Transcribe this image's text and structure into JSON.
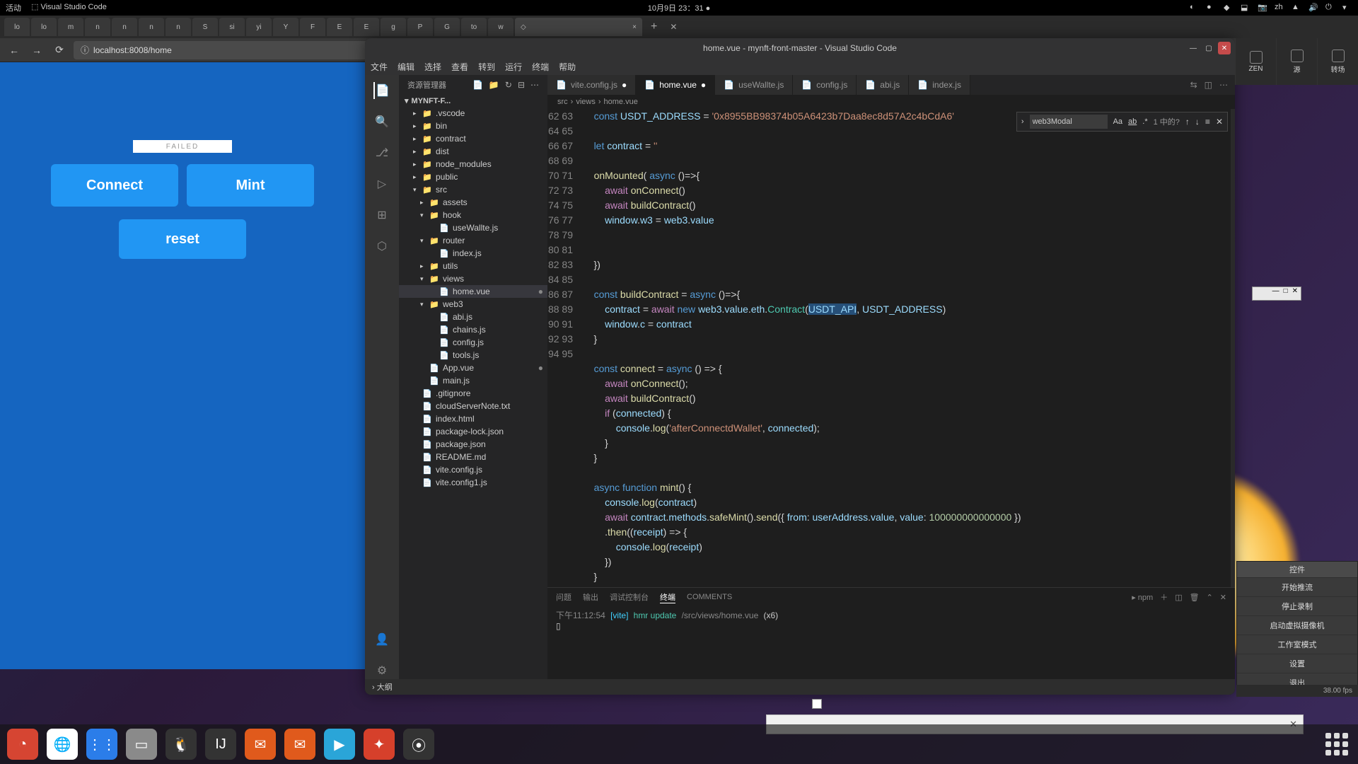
{
  "sys": {
    "activity": "活动",
    "app": "Visual Studio Code",
    "datetime": "10月9日 23：31"
  },
  "ff": {
    "tabs": [
      "lo",
      "lo",
      "m",
      "n",
      "n",
      "n",
      "n",
      "S",
      "si",
      "yi",
      "Y",
      "F",
      "E",
      "E",
      "g",
      "P",
      "G",
      "to",
      "w"
    ],
    "close": "×",
    "plus": "+",
    "url": "localhost:8008/home"
  },
  "page": {
    "failed": "FAILED",
    "connect": "Connect",
    "mint": "Mint",
    "reset": "reset"
  },
  "vsc": {
    "title": "home.vue - mynft-front-master - Visual Studio Code",
    "menu": [
      "文件",
      "编辑",
      "选择",
      "查看",
      "转到",
      "运行",
      "终端",
      "帮助"
    ],
    "side_hdr": "资源管理器",
    "root": "MYNFT-F...",
    "tree": [
      {
        "n": ".vscode",
        "d": 0,
        "f": true
      },
      {
        "n": "bin",
        "d": 0,
        "f": true
      },
      {
        "n": "contract",
        "d": 0,
        "f": true
      },
      {
        "n": "dist",
        "d": 0,
        "f": true
      },
      {
        "n": "node_modules",
        "d": 0,
        "f": true
      },
      {
        "n": "public",
        "d": 0,
        "f": true
      },
      {
        "n": "src",
        "d": 0,
        "f": true,
        "open": true
      },
      {
        "n": "assets",
        "d": 1,
        "f": true
      },
      {
        "n": "hook",
        "d": 1,
        "f": true,
        "open": true
      },
      {
        "n": "useWallte.js",
        "d": 2
      },
      {
        "n": "router",
        "d": 1,
        "f": true,
        "open": true
      },
      {
        "n": "index.js",
        "d": 2
      },
      {
        "n": "utils",
        "d": 1,
        "f": true
      },
      {
        "n": "views",
        "d": 1,
        "f": true,
        "open": true
      },
      {
        "n": "home.vue",
        "d": 2,
        "sel": true,
        "m": true
      },
      {
        "n": "web3",
        "d": 1,
        "f": true,
        "open": true
      },
      {
        "n": "abi.js",
        "d": 2
      },
      {
        "n": "chains.js",
        "d": 2
      },
      {
        "n": "config.js",
        "d": 2
      },
      {
        "n": "tools.js",
        "d": 2
      },
      {
        "n": "App.vue",
        "d": 1,
        "m": true
      },
      {
        "n": "main.js",
        "d": 1
      },
      {
        "n": ".gitignore",
        "d": 0
      },
      {
        "n": "cloudServerNote.txt",
        "d": 0
      },
      {
        "n": "index.html",
        "d": 0
      },
      {
        "n": "package-lock.json",
        "d": 0
      },
      {
        "n": "package.json",
        "d": 0
      },
      {
        "n": "README.md",
        "d": 0
      },
      {
        "n": "vite.config.js",
        "d": 0
      },
      {
        "n": "vite.config1.js",
        "d": 0
      }
    ],
    "tabs": [
      {
        "n": "vite.config.js",
        "m": true
      },
      {
        "n": "home.vue",
        "active": true,
        "m": true
      },
      {
        "n": "useWallte.js"
      },
      {
        "n": "config.js"
      },
      {
        "n": "abi.js"
      },
      {
        "n": "index.js"
      }
    ],
    "crumbs": [
      "src",
      "views",
      "home.vue"
    ],
    "find": {
      "value": "web3Modal",
      "result": "1 中的?"
    },
    "lines_start": 62,
    "lines_end": 95,
    "code_html": "    <span class='k'>const</span> <span class='v'>USDT_ADDRESS</span> = <span class='s'>'0x8955BB98374b05A6423b7Daa8ec8d57A2c4bCdA6'</span>\n\n    <span class='k'>let</span> <span class='v'>contract</span> = <span class='s'>''</span>\n\n    <span class='fn'>onMounted</span>( <span class='k'>async</span> ()=>&#123;\n        <span class='kw2'>await</span> <span class='fn'>onConnect</span>()\n        <span class='kw2'>await</span> <span class='fn'>buildContract</span>()\n        <span class='v'>window</span>.<span class='v'>w3</span> = <span class='v'>web3</span>.<span class='v'>value</span>\n\n\n    &#125;)\n\n    <span class='k'>const</span> <span class='fn'>buildContract</span> = <span class='k'>async</span> ()=>&#123;\n        <span class='v'>contract</span> = <span class='kw2'>await</span> <span class='k'>new</span> <span class='v'>web3</span>.<span class='v'>value</span>.<span class='v'>eth</span>.<span class='t'>Contract</span>(<span class='hl'><span class='v'>USDT_API</span></span>, <span class='v'>USDT_ADDRESS</span>)\n        <span class='v'>window</span>.<span class='v'>c</span> = <span class='v'>contract</span>\n    &#125;\n\n    <span class='k'>const</span> <span class='fn'>connect</span> = <span class='k'>async</span> () => &#123;\n        <span class='kw2'>await</span> <span class='fn'>onConnect</span>();\n        <span class='kw2'>await</span> <span class='fn'>buildContract</span>()\n        <span class='kw2'>if</span> (<span class='v'>connected</span>) &#123;\n            <span class='v'>console</span>.<span class='fn'>log</span>(<span class='s'>'afterConnectdWallet'</span>, <span class='v'>connected</span>);\n        &#125;\n    &#125;\n\n    <span class='k'>async</span> <span class='k'>function</span> <span class='fn'>mint</span>() &#123;\n        <span class='v'>console</span>.<span class='fn'>log</span>(<span class='v'>contract</span>)\n        <span class='kw2'>await</span> <span class='v'>contract</span>.<span class='v'>methods</span>.<span class='fn'>safeMint</span>().<span class='fn'>send</span>(&#123; <span class='v'>from</span>: <span class='v'>userAddress</span>.<span class='v'>value</span>, <span class='v'>value</span>: <span class='n'>100000000000000</span> &#125;)\n        .<span class='fn'>then</span>((<span class='v'>receipt</span>) => &#123;\n            <span class='v'>console</span>.<span class='fn'>log</span>(<span class='v'>receipt</span>)\n        &#125;)\n    &#125;\n\n    <span class='kw2'>return</span> &#123;",
    "term": {
      "tabs": [
        "问题",
        "输出",
        "调试控制台",
        "终端",
        "COMMENTS"
      ],
      "active": 3,
      "kind": "npm",
      "time": "下午11:12:54",
      "tag": "[vite]",
      "msg": "hmr update",
      "path": "/src/views/home.vue",
      "x": "(x6)",
      "prompt": "▯"
    },
    "status": {
      "outline": "大纲"
    }
  },
  "obs": {
    "cells": [
      "ZEN",
      "源",
      "转场"
    ],
    "ctrl_hdr": "控件",
    "ctrl": [
      "开始推流",
      "停止录制",
      "启动虚拟摄像机",
      "工作室模式",
      "设置",
      "退出"
    ],
    "fps": "38.00 fps"
  },
  "dock": [
    {
      "bg": "#d64532",
      "t": "◔"
    },
    {
      "bg": "#fff",
      "t": "🌐"
    },
    {
      "bg": "#2b7de9",
      "t": "⋮⋮"
    },
    {
      "bg": "#8a8a8a",
      "t": "▭"
    },
    {
      "bg": "#333",
      "t": "🐧"
    },
    {
      "bg": "#333",
      "t": "IJ"
    },
    {
      "bg": "#e05a1c",
      "t": "✉"
    },
    {
      "bg": "#e05a1c",
      "t": "✉"
    },
    {
      "bg": "#2aa5d8",
      "t": "▶"
    },
    {
      "bg": "#d6402b",
      "t": "✦"
    },
    {
      "bg": "#333",
      "t": "⦿"
    }
  ]
}
